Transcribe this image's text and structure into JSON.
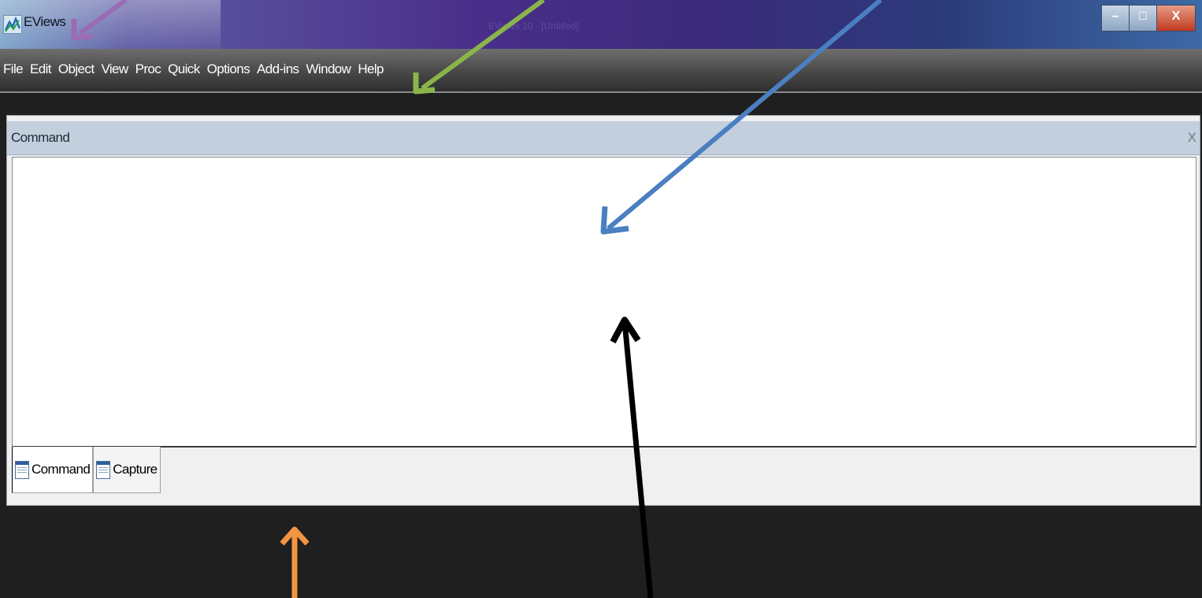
{
  "window": {
    "app_title": "EViews",
    "document_title": "EViews 10 - [Untitled]",
    "minimize_glyph": "–",
    "restore_glyph": "□",
    "close_glyph": "X"
  },
  "menubar": {
    "items": [
      "File",
      "Edit",
      "Object",
      "View",
      "Proc",
      "Quick",
      "Options",
      "Add-ins",
      "Window",
      "Help"
    ]
  },
  "command_panel": {
    "title": "Command",
    "close_label": "X",
    "command_text": "",
    "tabs": [
      {
        "label": "Command",
        "icon": "document-icon",
        "active": true
      },
      {
        "label": "Capture",
        "icon": "document-icon",
        "active": false
      }
    ]
  },
  "annotation_arrows": [
    {
      "color": "#9b6bb5",
      "target": "title-bar"
    },
    {
      "color": "#8ab54a",
      "target": "menu-bar"
    },
    {
      "color": "#4a7fc1",
      "target": "command-window"
    },
    {
      "color": "#000000",
      "target": "command-window"
    },
    {
      "color": "#f29442",
      "target": "work-area"
    }
  ]
}
